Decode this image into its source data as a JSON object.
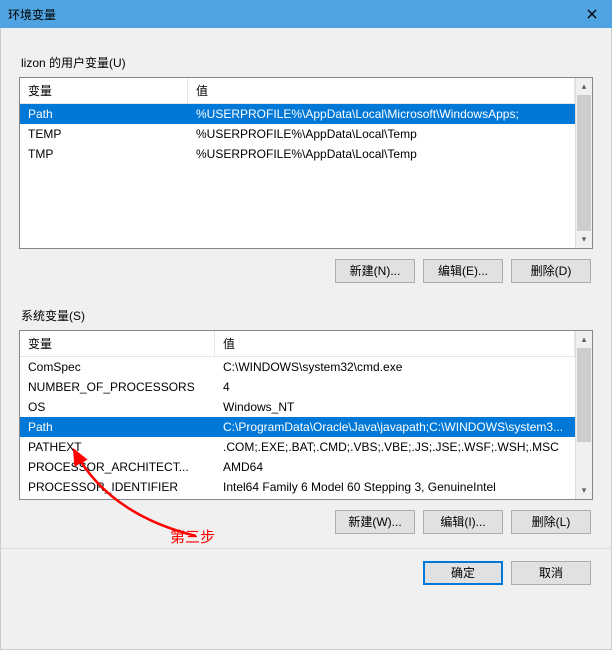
{
  "title": "环境变量",
  "user_section_label": "lizon 的用户变量(U)",
  "sys_section_label": "系统变量(S)",
  "columns": {
    "name": "变量",
    "value": "值"
  },
  "user_vars": [
    {
      "name": "Path",
      "value": "%USERPROFILE%\\AppData\\Local\\Microsoft\\WindowsApps;"
    },
    {
      "name": "TEMP",
      "value": "%USERPROFILE%\\AppData\\Local\\Temp"
    },
    {
      "name": "TMP",
      "value": "%USERPROFILE%\\AppData\\Local\\Temp"
    }
  ],
  "user_selected_index": 0,
  "sys_vars": [
    {
      "name": "ComSpec",
      "value": "C:\\WINDOWS\\system32\\cmd.exe"
    },
    {
      "name": "NUMBER_OF_PROCESSORS",
      "value": "4"
    },
    {
      "name": "OS",
      "value": "Windows_NT"
    },
    {
      "name": "Path",
      "value": "C:\\ProgramData\\Oracle\\Java\\javapath;C:\\WINDOWS\\system3..."
    },
    {
      "name": "PATHEXT",
      "value": ".COM;.EXE;.BAT;.CMD;.VBS;.VBE;.JS;.JSE;.WSF;.WSH;.MSC"
    },
    {
      "name": "PROCESSOR_ARCHITECT...",
      "value": "AMD64"
    },
    {
      "name": "PROCESSOR_IDENTIFIER",
      "value": "Intel64 Family 6 Model 60 Stepping 3, GenuineIntel"
    }
  ],
  "sys_selected_index": 3,
  "buttons": {
    "user_new": "新建(N)...",
    "user_edit": "编辑(E)...",
    "user_del": "删除(D)",
    "sys_new": "新建(W)...",
    "sys_edit": "编辑(I)...",
    "sys_del": "删除(L)",
    "ok": "确定",
    "cancel": "取消"
  },
  "annotation": "第三步"
}
